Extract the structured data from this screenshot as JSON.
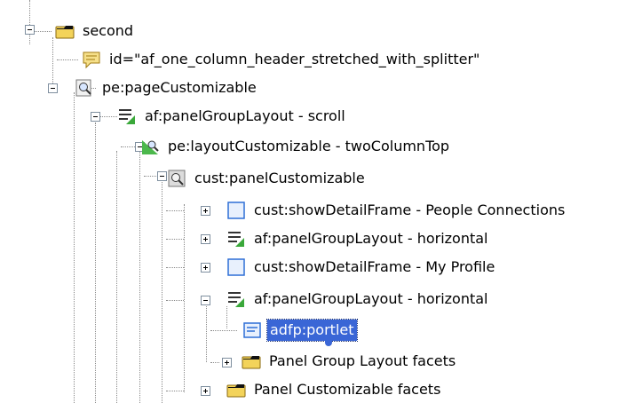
{
  "tree": {
    "nodes": [
      {
        "label": "second",
        "icon": "folder-icon"
      },
      {
        "label": "id=\"af_one_column_header_stretched_with_splitter\"",
        "icon": "comment-icon"
      },
      {
        "label": "pe:pageCustomizable",
        "icon": "magnifier-page-icon"
      },
      {
        "label": "af:panelGroupLayout - scroll",
        "icon": "panel-group-layout-icon"
      },
      {
        "label": "pe:layoutCustomizable - twoColumnTop",
        "icon": "layout-customizable-icon"
      },
      {
        "label": "cust:panelCustomizable",
        "icon": "panel-customizable-icon"
      },
      {
        "label": "cust:showDetailFrame - People Connections",
        "icon": "frame-icon"
      },
      {
        "label": "af:panelGroupLayout - horizontal",
        "icon": "panel-group-layout-icon"
      },
      {
        "label": "cust:showDetailFrame - My Profile",
        "icon": "frame-icon"
      },
      {
        "label": "af:panelGroupLayout - horizontal",
        "icon": "panel-group-layout-icon"
      },
      {
        "label": "adfp:portlet",
        "icon": "portlet-icon",
        "selected": true
      },
      {
        "label": "Panel Group Layout facets",
        "icon": "folder-icon"
      },
      {
        "label": "Panel Customizable facets",
        "icon": "folder-icon"
      }
    ]
  },
  "colors": {
    "selection": "#3a66d6",
    "folder": "#f3d35a",
    "frame": "#2e6fd6"
  }
}
